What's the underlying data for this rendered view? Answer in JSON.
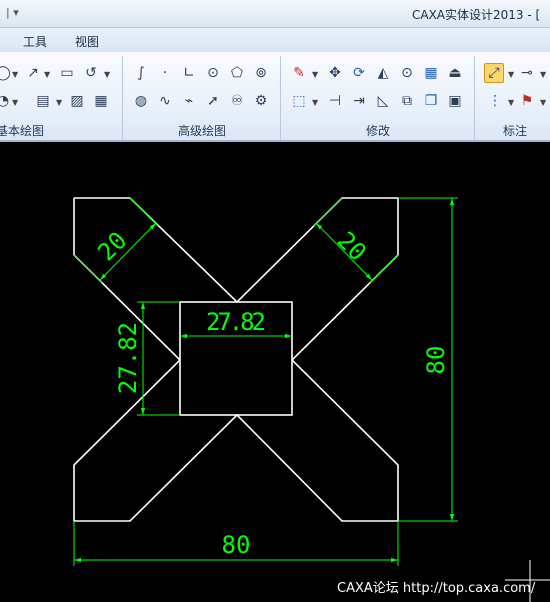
{
  "titlebar": {
    "quick_access": "|  ▾",
    "title": "CAXA实体设计2013 - ["
  },
  "menu": {
    "tools": "工具",
    "view": "视图"
  },
  "ribbon": {
    "groups": {
      "basic_drawing": "基本绘图",
      "advanced_drawing": "高级绘图",
      "modify": "修改",
      "annotate": "标注"
    }
  },
  "drawing": {
    "dim_square_top": "27.82",
    "dim_square_left": "27.82",
    "dim_arm_left": "20",
    "dim_arm_right": "20",
    "dim_height": "80",
    "dim_width": "80",
    "colors": {
      "background": "#000000",
      "geometry": "#ffffff",
      "dimension": "#00ff00"
    }
  },
  "watermark": "CAXA论坛 http://top.caxa.com/"
}
